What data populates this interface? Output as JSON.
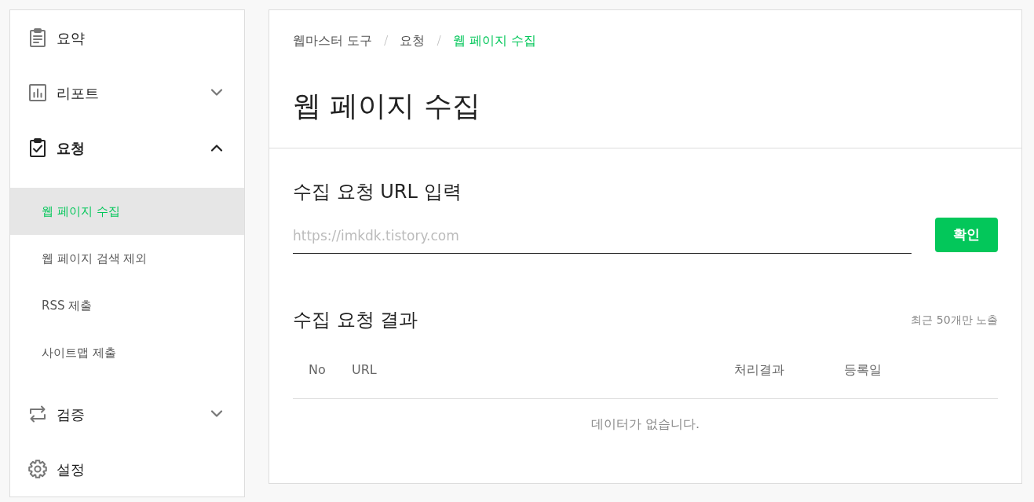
{
  "sidebar": {
    "items": [
      {
        "kind": "link",
        "label": "요약"
      },
      {
        "kind": "group",
        "label": "리포트",
        "expanded": false
      },
      {
        "kind": "group",
        "label": "요청",
        "expanded": true,
        "children": [
          {
            "label": "웹 페이지 수집",
            "selected": true
          },
          {
            "label": "웹 페이지 검색 제외",
            "selected": false
          },
          {
            "label": "RSS 제출",
            "selected": false
          },
          {
            "label": "사이트맵 제출",
            "selected": false
          }
        ]
      },
      {
        "kind": "group",
        "label": "검증",
        "expanded": false
      },
      {
        "kind": "link",
        "label": "설정"
      }
    ]
  },
  "breadcrumb": {
    "items": [
      {
        "label": "웹마스터 도구",
        "current": false
      },
      {
        "label": "요청",
        "current": false
      },
      {
        "label": "웹 페이지 수집",
        "current": true
      }
    ],
    "separators": [
      "/",
      "/"
    ]
  },
  "page_title": "웹 페이지 수집",
  "url_form": {
    "heading": "수집 요청 URL 입력",
    "placeholder": "https://imkdk.tistory.com",
    "button": "확인"
  },
  "results": {
    "heading": "수집 요청 결과",
    "note": "최근 50개만 노출",
    "table": {
      "columns": [
        "No",
        "URL",
        "처리결과",
        "등록일"
      ],
      "empty_message": "데이터가 없습니다."
    }
  }
}
